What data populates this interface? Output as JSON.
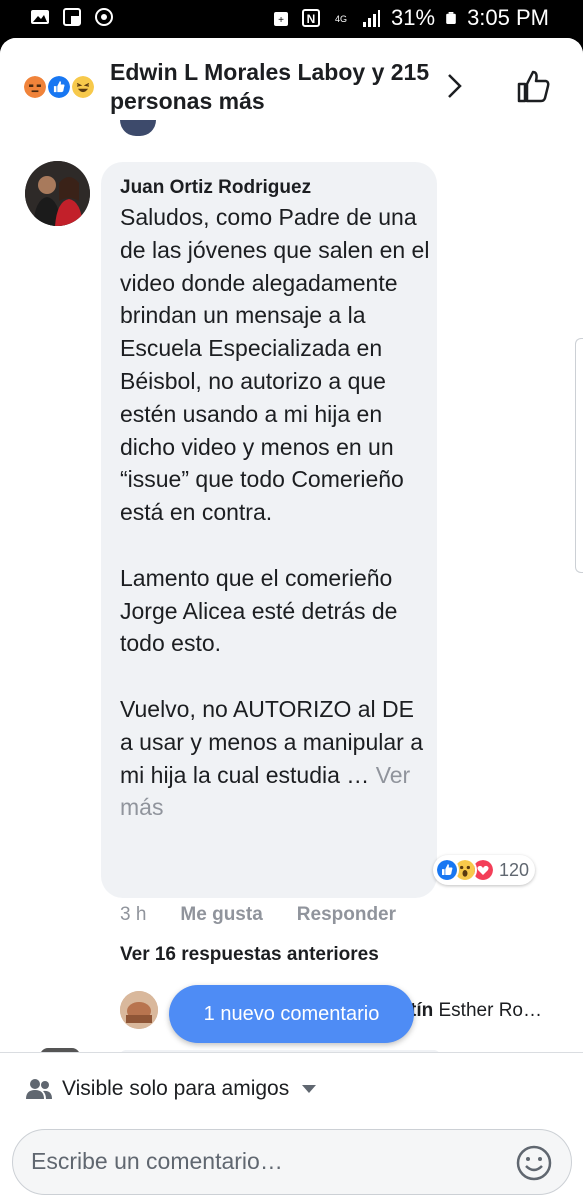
{
  "status_bar": {
    "battery_percent": "31%",
    "time": "3:05 PM"
  },
  "header": {
    "title": "Edwin L Morales Laboy y 215 personas más",
    "reaction_icons": [
      "angry-icon",
      "like-icon",
      "haha-icon"
    ]
  },
  "comment": {
    "author": "Juan Ortiz Rodriguez",
    "body": "Saludos, como Padre de una de las jóvenes que salen en el video donde alegadamente brindan un mensaje a la Escuela Especializada en Béisbol, no autorizo a que estén usando a mi hija en dicho video y menos en un “issue” que todo Comerieño está en contra.\n\nLamento que el comerieño Jorge Alicea esté detrás de todo esto.\n\nVuelvo, no AUTORIZO al DE a usar y menos a manipular a mi hija la cual estudia … ",
    "see_more": "Ver más",
    "reaction_count": "120",
    "time": "3 h",
    "like_label": "Me gusta",
    "reply_label": "Responder",
    "previous_replies": "Ver 16 respuestas anteriores",
    "reply_name_bold": "tín",
    "reply_name_rest": " Esther Ro…"
  },
  "new_comment_pill": "1 nuevo comentario",
  "footer": {
    "visibility": "Visible solo para amigos",
    "comment_placeholder": "Escribe un comentario…"
  },
  "colors": {
    "like_blue": "#4e8cf5",
    "bubble_gray": "#f0f2f5",
    "meta_gray": "#90949c"
  }
}
